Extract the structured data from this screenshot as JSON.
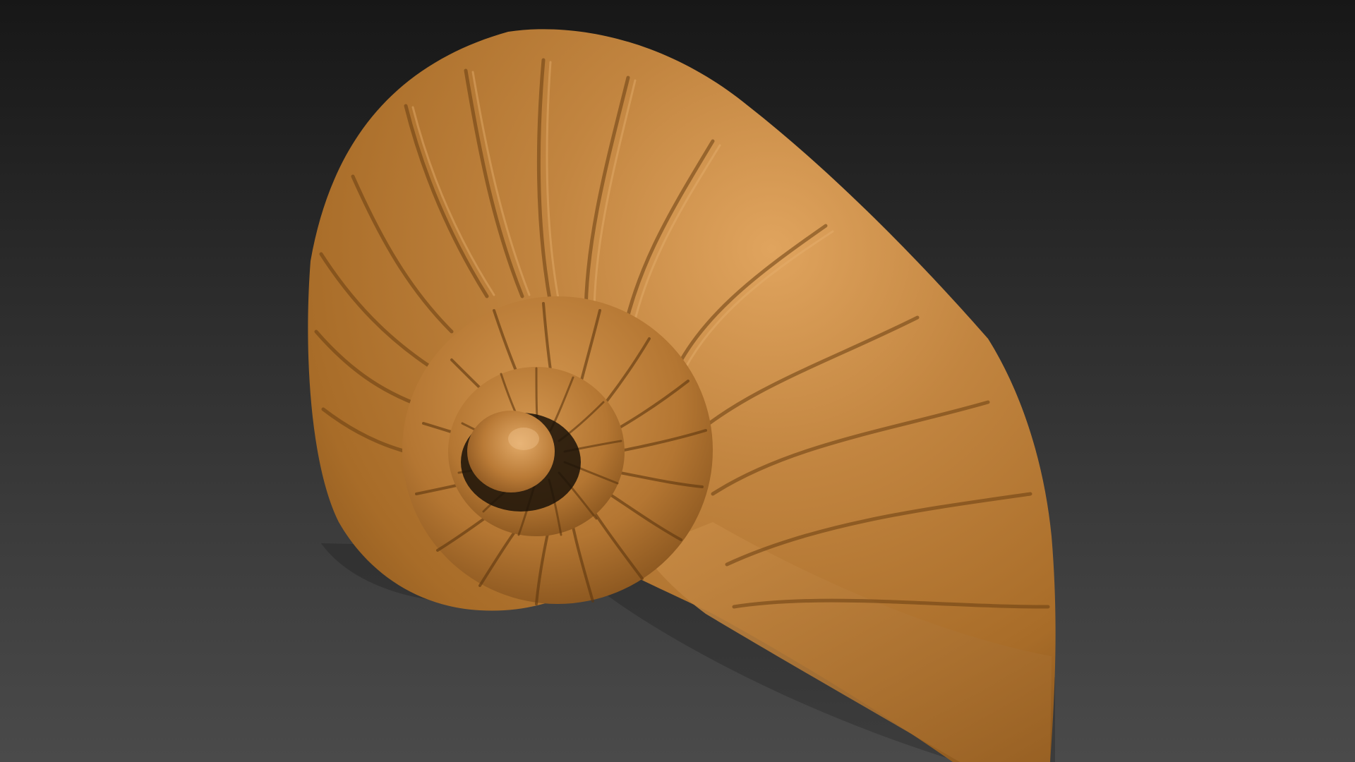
{
  "scene": {
    "background_top": "#171717",
    "background_bottom": "#4a4a4a",
    "model": {
      "subject": "nautilus-shell-sculpt",
      "base_color": "#b87a32",
      "highlight_color": "#d99a52",
      "shadow_color": "#6e4317"
    }
  }
}
